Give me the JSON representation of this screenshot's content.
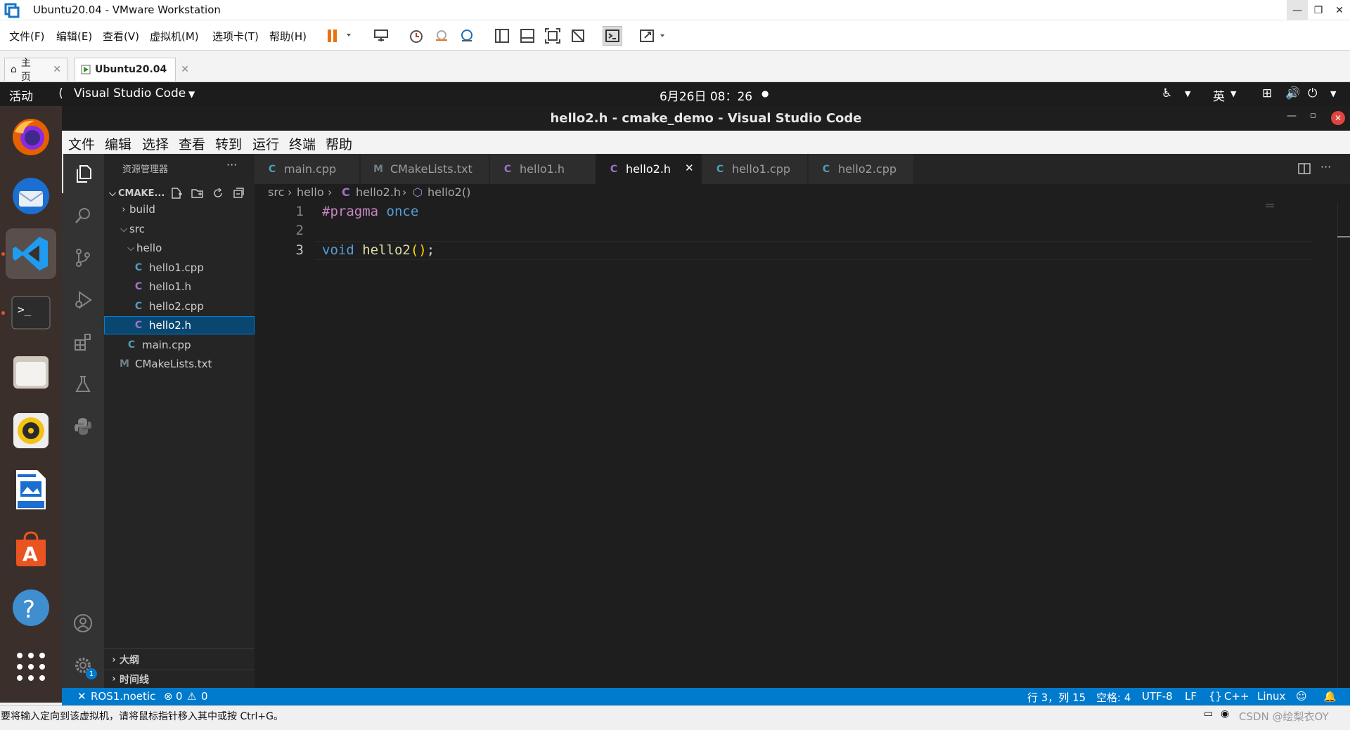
{
  "vmware": {
    "window_title": "Ubuntu20.04 - VMware Workstation",
    "menu": [
      "文件(F)",
      "编辑(E)",
      "查看(V)",
      "虚拟机(M)",
      "选项卡(T)",
      "帮助(H)"
    ],
    "tabs": [
      {
        "label": "主页"
      },
      {
        "label": "Ubuntu20.04"
      }
    ],
    "status_text": "要将输入定向到该虚拟机，请将鼠标指针移入其中或按 Ctrl+G。",
    "watermark": "CSDN @绘梨衣OY"
  },
  "gnome": {
    "activities": "活动",
    "app_name": "Visual Studio Code",
    "clock": "6月26日  08：26",
    "input_method": "英"
  },
  "vscode": {
    "window_title": "hello2.h - cmake_demo - Visual Studio Code",
    "menu": [
      "文件",
      "编辑",
      "选择",
      "查看",
      "转到",
      "运行",
      "终端",
      "帮助"
    ],
    "explorer": {
      "title": "资源管理器",
      "root": "CMAKE...",
      "tree": [
        {
          "label": "build",
          "kind": "folder",
          "expanded": false
        },
        {
          "label": "src",
          "kind": "folder",
          "expanded": true
        },
        {
          "label": "hello",
          "kind": "folder",
          "expanded": true
        },
        {
          "label": "hello1.cpp",
          "kind": "cpp"
        },
        {
          "label": "hello1.h",
          "kind": "h"
        },
        {
          "label": "hello2.cpp",
          "kind": "cpp"
        },
        {
          "label": "hello2.h",
          "kind": "h",
          "selected": true
        },
        {
          "label": "main.cpp",
          "kind": "cpp"
        },
        {
          "label": "CMakeLists.txt",
          "kind": "cmake"
        }
      ],
      "outline": "大纲",
      "timeline": "时间线"
    },
    "tabs": [
      {
        "label": "main.cpp",
        "kind": "cpp"
      },
      {
        "label": "CMakeLists.txt",
        "kind": "cmake"
      },
      {
        "label": "hello1.h",
        "kind": "h"
      },
      {
        "label": "hello2.h",
        "kind": "h",
        "active": true
      },
      {
        "label": "hello1.cpp",
        "kind": "cpp"
      },
      {
        "label": "hello2.cpp",
        "kind": "cpp"
      }
    ],
    "breadcrumb": {
      "p1": "src",
      "p2": "hello",
      "p3": "hello2.h",
      "p4": "hello2()"
    },
    "code": {
      "line_numbers": [
        "1",
        "2",
        "3"
      ],
      "l1_directive": "#pragma",
      "l1_arg": "once",
      "l3_type": "void",
      "l3_name": "hello2",
      "l3_paren": "()",
      "l3_semi": ";"
    },
    "settings_badge": "1",
    "status": {
      "remote": "ROS1.noetic",
      "errors": "0",
      "warnings": "0",
      "position": "行 3，列 15",
      "spaces": "空格: 4",
      "encoding": "UTF-8",
      "eol": "LF",
      "language": "C++",
      "platform": "Linux"
    }
  },
  "colors": {
    "accent": "#007acc",
    "selection": "#094771",
    "cpp_icon": "#519aba",
    "h_icon": "#a074c4",
    "cmake_icon": "#6d8086",
    "ubuntu_orange": "#e95420"
  }
}
